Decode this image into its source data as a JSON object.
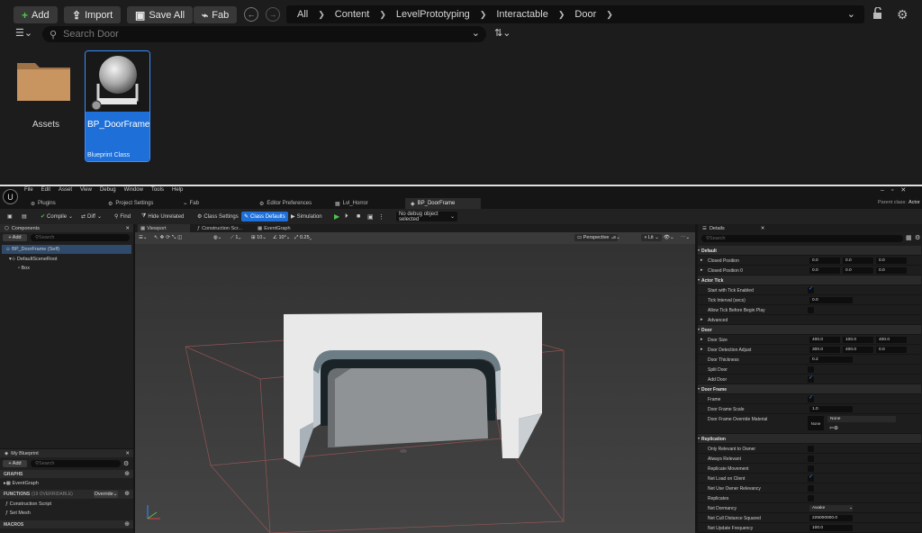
{
  "content_browser": {
    "toolbar": {
      "add": "Add",
      "import": "Import",
      "save_all": "Save All",
      "fab": "Fab"
    },
    "path": [
      "All",
      "Content",
      "LevelPrototyping",
      "Interactable",
      "Door"
    ],
    "search_placeholder": "Search Door",
    "assets": [
      {
        "name": "Assets",
        "type": "folder"
      },
      {
        "name": "BP_DoorFrame",
        "type": "Blueprint Class",
        "selected": true
      }
    ]
  },
  "editor": {
    "menu": [
      "File",
      "Edit",
      "Asset",
      "View",
      "Debug",
      "Window",
      "Tools",
      "Help"
    ],
    "tabs": [
      "Plugins",
      "Project Settings",
      "Fab",
      "Editor Preferences",
      "Lvl_Horror",
      "BP_DoorFrame"
    ],
    "active_tab": "BP_DoorFrame",
    "parent_class_label": "Parent class:",
    "parent_class_value": "Actor",
    "toolbar": {
      "compile": "Compile",
      "diff": "Diff",
      "find": "Find",
      "hide_unrelated": "Hide Unrelated",
      "class_settings": "Class Settings",
      "class_defaults": "Class Defaults",
      "simulation": "Simulation",
      "debug_object": "No debug object selected"
    },
    "components": {
      "title": "Components",
      "add": "+ Add",
      "search_placeholder": "Search",
      "items": [
        "BP_DoorFrame (Self)",
        "DefaultSceneRoot",
        "Box"
      ]
    },
    "viewport_tabs": [
      "Viewport",
      "Construction Scr...",
      "EventGraph"
    ],
    "viewport_toolbar": {
      "perspective": "Perspective",
      "lit": "Lit",
      "grid": "10",
      "angle": "10°",
      "scale": "0.25",
      "num": "1"
    },
    "my_blueprint": {
      "title": "My Blueprint",
      "add": "+ Add",
      "search_placeholder": "Search",
      "graphs_label": "GRAPHS",
      "event_graph": "EventGraph",
      "functions_label": "FUNCTIONS",
      "functions_count": "(19 OVERRIDABLE)",
      "override": "Override",
      "functions": [
        "Construction Script",
        "Set Mesh"
      ],
      "macros_label": "MACROS"
    },
    "details": {
      "title": "Details",
      "search_placeholder": "Search",
      "rows": [
        {
          "kind": "section",
          "label": "Default"
        },
        {
          "kind": "vec",
          "label": "Closed Position",
          "values": [
            "0.0",
            "0.0",
            "0.0"
          ]
        },
        {
          "kind": "vec",
          "label": "Closed Position 0",
          "values": [
            "0.0",
            "0.0",
            "0.0"
          ]
        },
        {
          "kind": "section",
          "label": "Actor Tick"
        },
        {
          "kind": "check",
          "label": "Start with Tick Enabled",
          "checked": true
        },
        {
          "kind": "num",
          "label": "Tick Interval (secs)",
          "value": "0.0"
        },
        {
          "kind": "check",
          "label": "Allow Tick Before Begin Play",
          "checked": false
        },
        {
          "kind": "label",
          "label": "Advanced"
        },
        {
          "kind": "section",
          "label": "Door"
        },
        {
          "kind": "vec",
          "label": "Door Size",
          "values": [
            "400.0",
            "100.0",
            "400.0"
          ]
        },
        {
          "kind": "vec",
          "label": "Door Detection Adjust",
          "values": [
            "300.0",
            "400.0",
            "0.0"
          ]
        },
        {
          "kind": "num",
          "label": "Door Thickness",
          "value": "0.2"
        },
        {
          "kind": "check",
          "label": "Split Door",
          "checked": false
        },
        {
          "kind": "check",
          "label": "Add Door",
          "checked": true
        },
        {
          "kind": "section",
          "label": "Door Frame"
        },
        {
          "kind": "check",
          "label": "Frame",
          "checked": true
        },
        {
          "kind": "num",
          "label": "Door Frame Scale",
          "value": "1.0"
        },
        {
          "kind": "material",
          "label": "Door Frame Override Material",
          "value": "None",
          "thumb": "None"
        },
        {
          "kind": "section",
          "label": "Replication"
        },
        {
          "kind": "check",
          "label": "Only Relevant to Owner",
          "checked": false
        },
        {
          "kind": "check",
          "label": "Always Relevant",
          "checked": false
        },
        {
          "kind": "check",
          "label": "Replicate Movement",
          "checked": false
        },
        {
          "kind": "check",
          "label": "Net Load on Client",
          "checked": true
        },
        {
          "kind": "check",
          "label": "Net Use Owner Relevancy",
          "checked": false
        },
        {
          "kind": "check",
          "label": "Replicates",
          "checked": false
        },
        {
          "kind": "select",
          "label": "Net Dormancy",
          "value": "Awake"
        },
        {
          "kind": "num",
          "label": "Net Cull Distance Squared",
          "value": "225000000.0"
        },
        {
          "kind": "num",
          "label": "Net Update Frequency",
          "value": "100.0"
        }
      ]
    }
  },
  "colors": {
    "accent": "#1e70d8",
    "selected": "#3c8dff",
    "check": "#2f8bff"
  }
}
